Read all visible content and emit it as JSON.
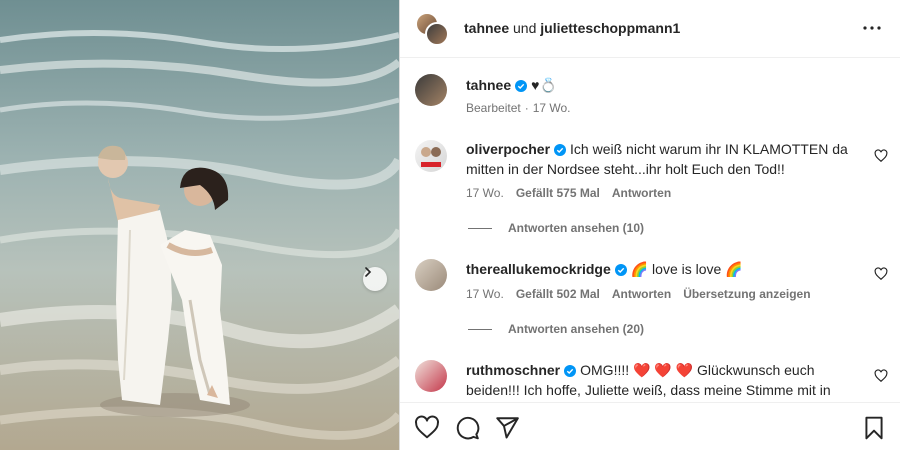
{
  "post": {
    "header": {
      "author_1": "tahnee",
      "conjunction": "und",
      "author_2": "julietteschoppmann1"
    },
    "caption": {
      "username": "tahnee",
      "text": "♥💍",
      "edited": "Bearbeitet",
      "age": "17 Wo."
    }
  },
  "comments": [
    {
      "username": "oliverpocher",
      "verified": true,
      "text": "Ich weiß nicht warum ihr IN KLAMOTTEN da mitten in der Nordsee steht...ihr holt Euch den Tod!!",
      "age": "17 Wo.",
      "likes": "Gefällt 575 Mal",
      "reply": "Antworten",
      "view_replies": "Antworten ansehen (10)"
    },
    {
      "username": "thereallukemockridge",
      "verified": true,
      "text": "🌈 love is love 🌈",
      "age": "17 Wo.",
      "likes": "Gefällt 502 Mal",
      "reply": "Antworten",
      "translate": "Übersetzung anzeigen",
      "view_replies": "Antworten ansehen (20)"
    },
    {
      "username": "ruthmoschner",
      "verified": true,
      "text": "OMG!!!! ❤️ ❤️ ❤️ Glückwunsch euch beiden!!! Ich hoffe, Juliette weiß, dass meine Stimme mit in"
    }
  ],
  "colors": {
    "verified": "#0095f6",
    "muted_text": "#737373",
    "border": "#dbdbdb"
  },
  "icons": [
    "more-icon",
    "heart-icon",
    "comment-icon",
    "share-icon",
    "bookmark-icon",
    "chevron-right-icon",
    "verified-icon"
  ]
}
